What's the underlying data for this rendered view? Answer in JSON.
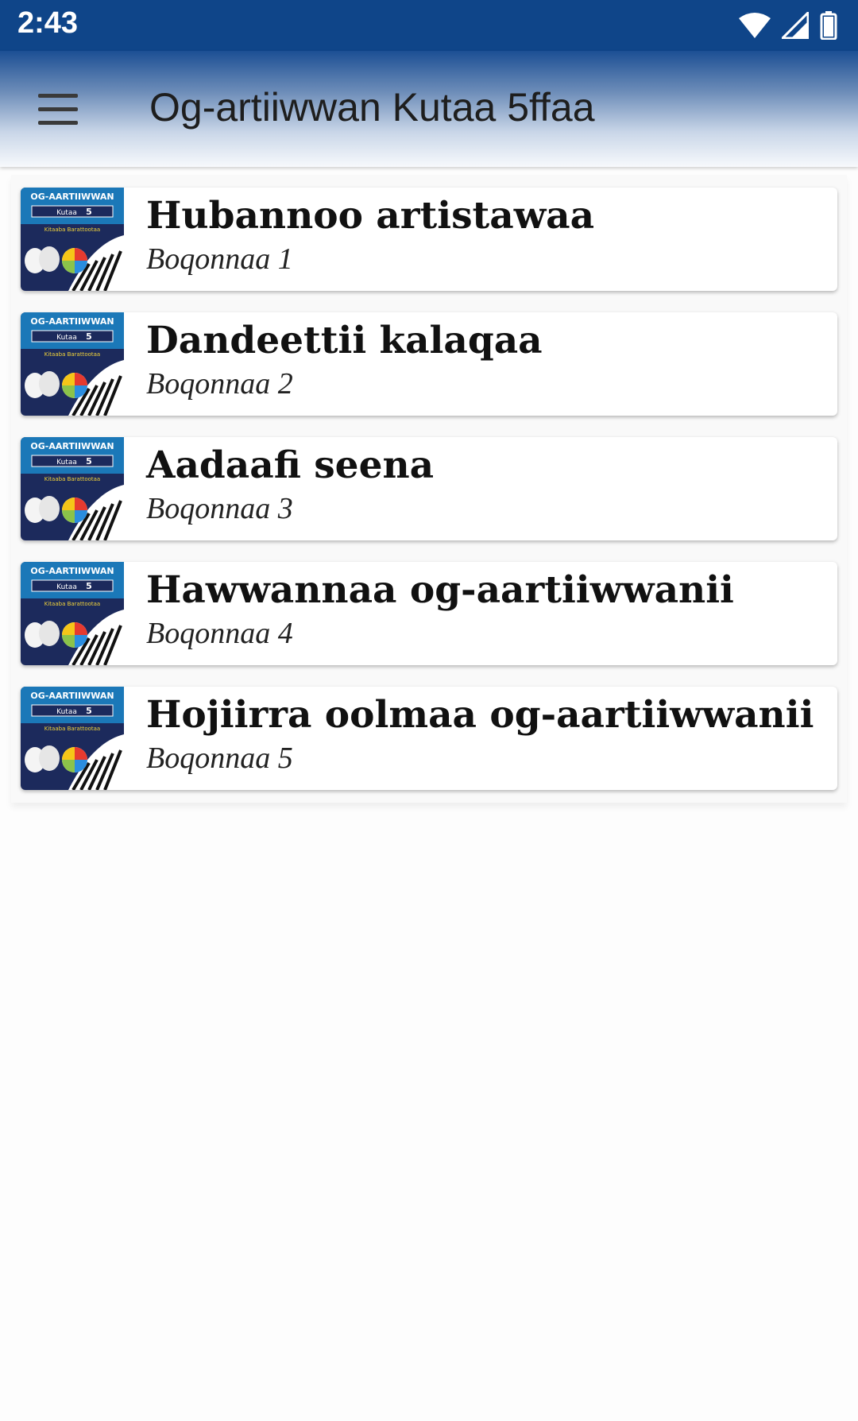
{
  "status_bar": {
    "time": "2:43",
    "icons": [
      "wifi-icon",
      "cell-signal-icon",
      "battery-icon"
    ]
  },
  "app_bar": {
    "title": "Og-artiiwwan Kutaa 5ffaa",
    "menu_icon": "hamburger-menu-icon"
  },
  "thumbnail": {
    "line1": "OG-AARTIIWWAN",
    "line2": "Kutaa",
    "line3": "5",
    "line4": "Kitaaba Barattootaa"
  },
  "chapters": [
    {
      "title": "Hubannoo artistawaa",
      "subtitle": "Boqonnaa 1"
    },
    {
      "title": "Dandeettii kalaqaa",
      "subtitle": "Boqonnaa 2"
    },
    {
      "title": "Aadaafi seena",
      "subtitle": "Boqonnaa 3"
    },
    {
      "title": "Hawwannaa og-aartiiwwanii",
      "subtitle": "Boqonnaa 4"
    },
    {
      "title": "Hojiirra oolmaa og-aartiiwwanii",
      "subtitle": "Boqonnaa 5"
    }
  ],
  "colors": {
    "status_bar": "#0f4589",
    "thumb_bg": "#1c2a5c",
    "thumb_header": "#1b78b8"
  }
}
